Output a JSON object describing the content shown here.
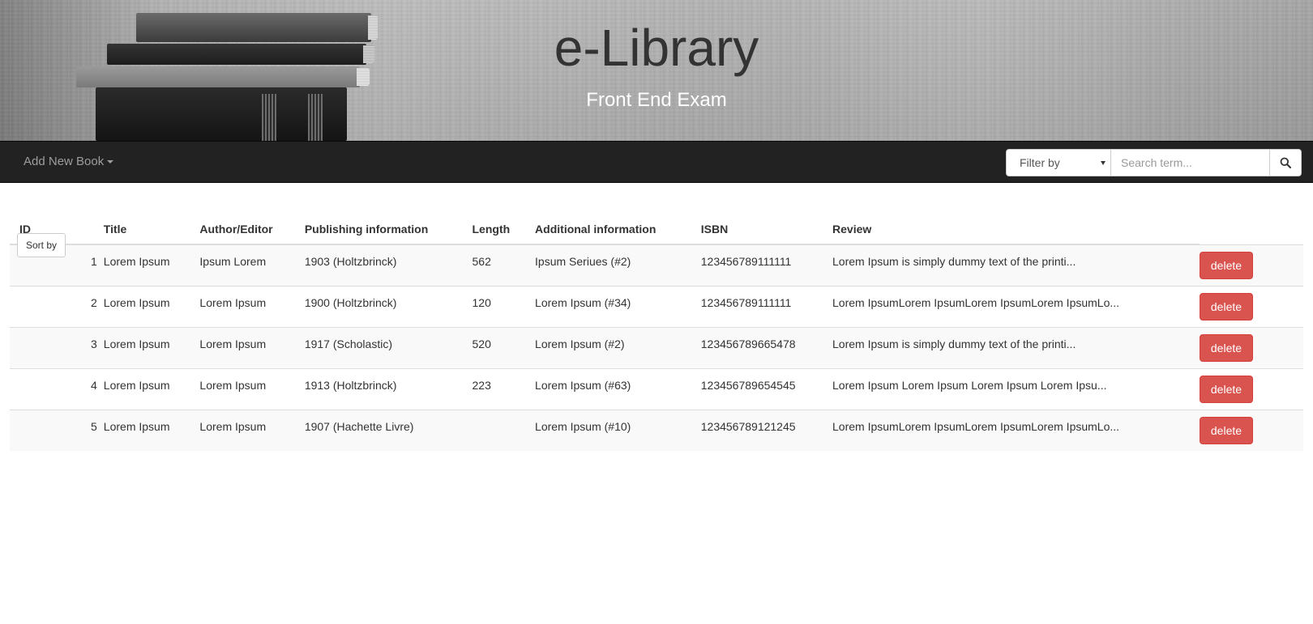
{
  "banner": {
    "title": "e-Library",
    "subtitle": "Front End Exam"
  },
  "navbar": {
    "add_new_book": "Add New Book",
    "filter_select": "Filter by",
    "search_placeholder": "Search term..."
  },
  "table": {
    "sort_button": "Sort by",
    "columns": [
      "ID",
      "Title",
      "Author/Editor",
      "Publishing information",
      "Length",
      "Additional information",
      "ISBN",
      "Review"
    ],
    "delete_label": "delete",
    "rows": [
      {
        "id": "1",
        "title": "Lorem Ipsum",
        "author": "Ipsum Lorem",
        "publishing": "1903 (Holtzbrinck)",
        "length": "562",
        "additional": "Ipsum Seriues (#2)",
        "isbn": "123456789111111",
        "review": "Lorem Ipsum is simply dummy text of the printi..."
      },
      {
        "id": "2",
        "title": "Lorem Ipsum",
        "author": "Lorem Ipsum",
        "publishing": "1900 (Holtzbrinck)",
        "length": "120",
        "additional": "Lorem Ipsum (#34)",
        "isbn": "123456789111111",
        "review": "Lorem IpsumLorem IpsumLorem IpsumLorem IpsumLo..."
      },
      {
        "id": "3",
        "title": "Lorem Ipsum",
        "author": "Lorem Ipsum",
        "publishing": "1917 (Scholastic)",
        "length": "520",
        "additional": "Lorem Ipsum (#2)",
        "isbn": "123456789665478",
        "review": "Lorem Ipsum is simply dummy text of the printi..."
      },
      {
        "id": "4",
        "title": "Lorem Ipsum",
        "author": "Lorem Ipsum",
        "publishing": "1913 (Holtzbrinck)",
        "length": "223",
        "additional": "Lorem Ipsum (#63)",
        "isbn": "123456789654545",
        "review": "Lorem Ipsum Lorem Ipsum Lorem Ipsum Lorem Ipsu..."
      },
      {
        "id": "5",
        "title": "Lorem Ipsum",
        "author": "Lorem Ipsum",
        "publishing": "1907 (Hachette Livre)",
        "length": "",
        "additional": "Lorem Ipsum (#10)",
        "isbn": "123456789121245",
        "review": "Lorem IpsumLorem IpsumLorem IpsumLorem IpsumLo..."
      }
    ]
  },
  "colors": {
    "navbar_bg": "#222222",
    "delete_btn": "#d9534f",
    "stripe": "#f9f9f9"
  }
}
